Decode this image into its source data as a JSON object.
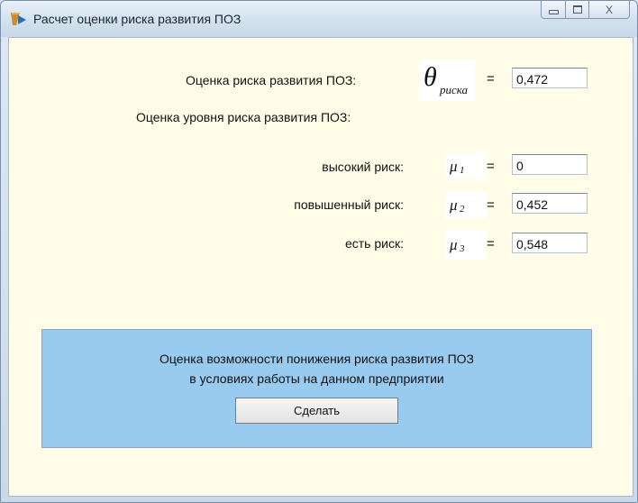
{
  "window": {
    "title": "Расчет оценки риска развития ПОЗ",
    "controls": {
      "minimize": "minimize",
      "maximize": "maximize",
      "close": "X"
    }
  },
  "main": {
    "risk_label": "Оценка риска развития ПОЗ:",
    "theta_symbol": "θ",
    "theta_subscript": "риска",
    "equals": "=",
    "risk_value": "0,472",
    "level_heading": "Оценка уровня риска развития ПОЗ:",
    "levels": [
      {
        "label": "высокий риск:",
        "symbol": "μ",
        "sub": "1",
        "value": "0"
      },
      {
        "label": "повышенный риск:",
        "symbol": "μ",
        "sub": "2",
        "value": "0,452"
      },
      {
        "label": "есть риск:",
        "symbol": "μ",
        "sub": "3",
        "value": "0,548"
      }
    ]
  },
  "panel": {
    "line1": "Оценка возможности понижения риска развития ПОЗ",
    "line2": "в условиях работы на данном предприятии",
    "button_label": "Сделать",
    "color": "#99cbf0"
  },
  "colors": {
    "client_bg": "#fffde8"
  }
}
